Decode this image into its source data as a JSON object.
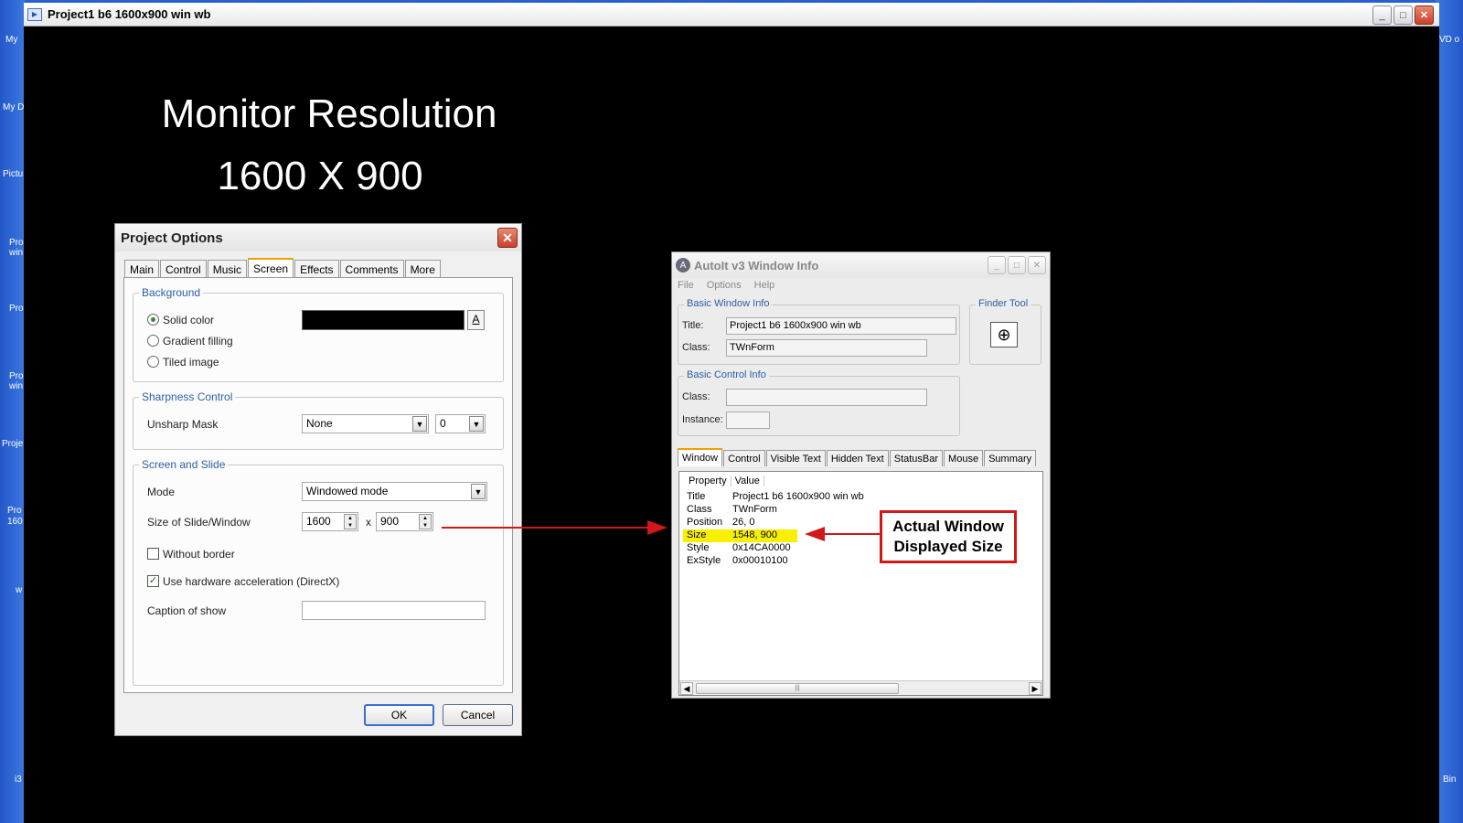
{
  "desktop": {
    "left_labels": [
      "My",
      "My D",
      "Pictu",
      "Pro win",
      "Pro",
      "Pro win",
      "Proje",
      "Pro 160",
      "w",
      "i3"
    ],
    "right_labels": [
      "VD o",
      "Bin"
    ]
  },
  "main_window": {
    "title": "Project1 b6 1600x900 win wb",
    "headline_1": "Monitor Resolution",
    "headline_2": "1600 X 900"
  },
  "project_options": {
    "title": "Project Options",
    "tabs": [
      "Main",
      "Control",
      "Music",
      "Screen",
      "Effects",
      "Comments",
      "More"
    ],
    "active_tab": "Screen",
    "background_group": "Background",
    "solid_color": "Solid color",
    "gradient_filling": "Gradient filling",
    "tiled_image": "Tiled image",
    "color_button": "A",
    "sharpness_group": "Sharpness Control",
    "unsharp_mask_label": "Unsharp Mask",
    "unsharp_mask_value": "None",
    "unsharp_amount_value": "0",
    "screen_group": "Screen and Slide",
    "mode_label": "Mode",
    "mode_value": "Windowed mode",
    "size_label": "Size of Slide/Window",
    "width_value": "1600",
    "size_x": "x",
    "height_value": "900",
    "without_border": "Without border",
    "hardware_accel": "Use hardware acceleration (DirectX)",
    "caption_label": "Caption of show",
    "caption_value": "",
    "ok_label": "OK",
    "cancel_label": "Cancel",
    "background_color": "#000000"
  },
  "autoit": {
    "title": "AutoIt v3 Window Info",
    "menu": [
      "File",
      "Options",
      "Help"
    ],
    "basic_window_group": "Basic Window Info",
    "title_label": "Title:",
    "title_value": "Project1 b6 1600x900 win wb",
    "class_label": "Class:",
    "class_value": "TWnForm",
    "finder_group": "Finder Tool",
    "basic_control_group": "Basic Control Info",
    "control_class_label": "Class:",
    "control_class_value": "",
    "instance_label": "Instance:",
    "instance_value": "",
    "tabs": [
      "Window",
      "Control",
      "Visible Text",
      "Hidden Text",
      "StatusBar",
      "Mouse",
      "Summary"
    ],
    "active_tab": "Window",
    "list_headers": [
      "Property",
      "Value"
    ],
    "properties": [
      {
        "key": "Title",
        "value": "Project1 b6 1600x900 win wb"
      },
      {
        "key": "Class",
        "value": "TWnForm"
      },
      {
        "key": "Position",
        "value": "26, 0"
      },
      {
        "key": "Size",
        "value": "1548, 900"
      },
      {
        "key": "Style",
        "value": "0x14CA0000"
      },
      {
        "key": "ExStyle",
        "value": "0x00010100"
      }
    ],
    "highlight_color": "#f8f000"
  },
  "callout": {
    "line_1": "Actual Window",
    "line_2": "Displayed Size",
    "arrow_color": "#d01818"
  }
}
